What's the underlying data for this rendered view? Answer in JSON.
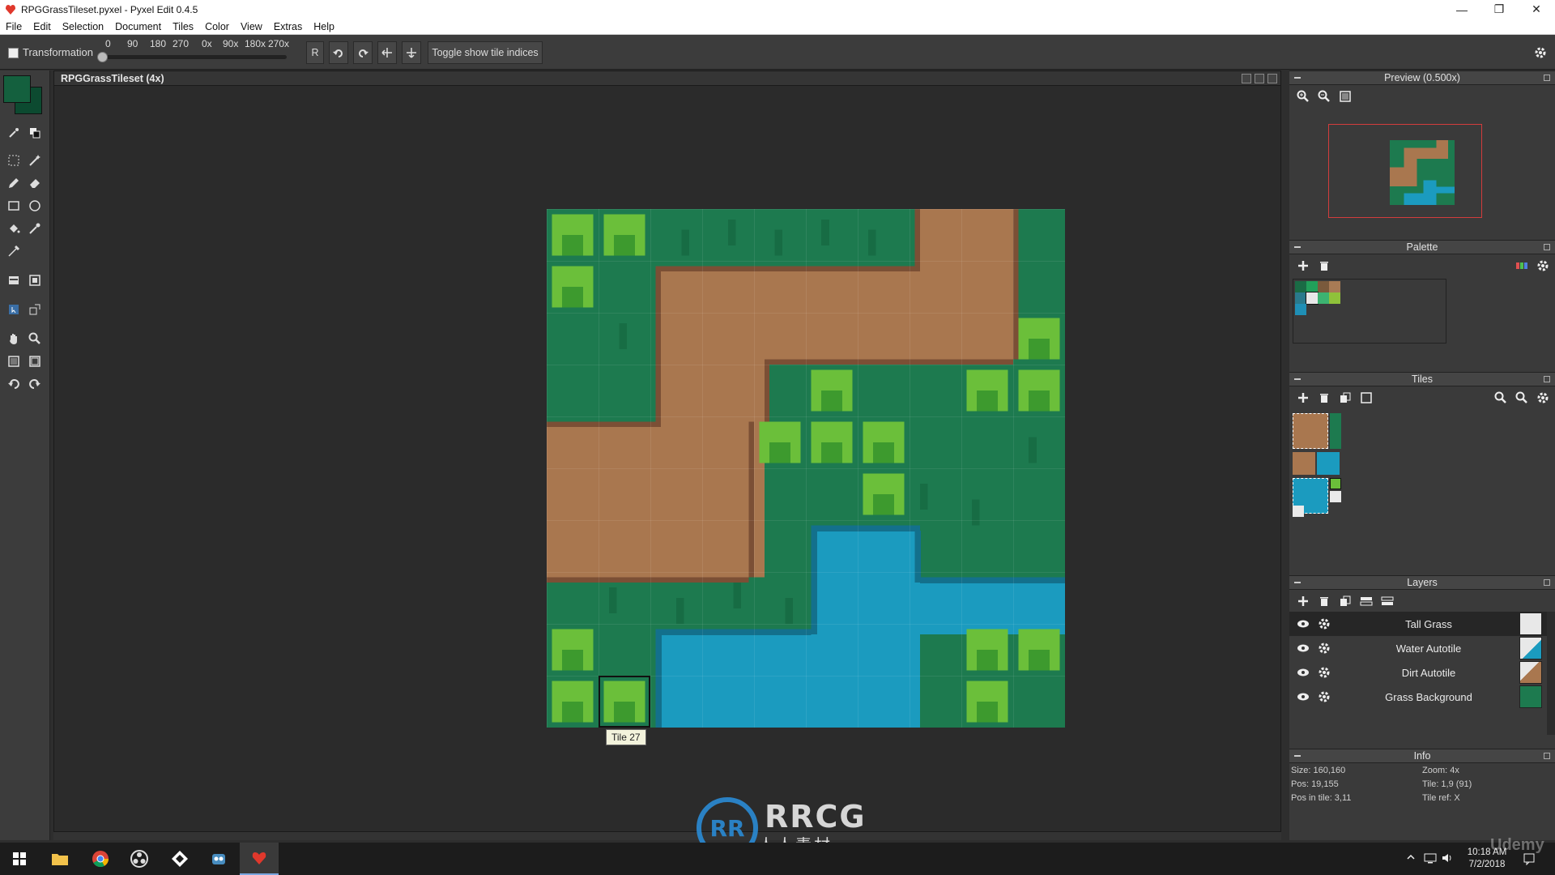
{
  "window": {
    "title": "RPGGrassTileset.pyxel - Pyxel Edit 0.4.5",
    "minimize": "—",
    "maximize": "❐",
    "close": "✕"
  },
  "menu": [
    "File",
    "Edit",
    "Selection",
    "Document",
    "Tiles",
    "Color",
    "View",
    "Extras",
    "Help"
  ],
  "toolbar": {
    "transformation_label": "Transformation",
    "rotation_ticks": [
      "0",
      "90",
      "180",
      "270",
      "0x",
      "90x",
      "180x",
      "270x"
    ],
    "r_label": "R",
    "toggle_label": "Toggle show tile indices"
  },
  "document": {
    "title": "RPGGrassTileset   (4x)",
    "tooltip": "Tile 27"
  },
  "preview": {
    "title": "Preview (0.500x)"
  },
  "palette": {
    "title": "Palette",
    "colors": [
      "#1a6b45",
      "#21a05a",
      "#7a5a3c",
      "#a87b55",
      "#2a7a8c",
      "#e8e8e8",
      "#3cb371",
      "#8fc23a",
      "#1f8fb5"
    ]
  },
  "tiles": {
    "title": "Tiles"
  },
  "layers": {
    "title": "Layers",
    "items": [
      {
        "name": "Tall Grass"
      },
      {
        "name": "Water Autotile"
      },
      {
        "name": "Dirt Autotile"
      },
      {
        "name": "Grass Background"
      }
    ]
  },
  "info": {
    "title": "Info",
    "size": "Size: 160,160",
    "zoom": "Zoom: 4x",
    "pos": "Pos: 19,155",
    "tile": "Tile: 1,9 (91)",
    "pos_in_tile": "Pos in tile: 3,11",
    "tile_ref": "Tile ref: X"
  },
  "taskbar": {
    "time": "10:18 AM",
    "date": "7/2/2018"
  },
  "watermark": {
    "text": "RRCG",
    "sub": "人人素材",
    "badge": "RR"
  },
  "corner_watermark": "Udemy"
}
